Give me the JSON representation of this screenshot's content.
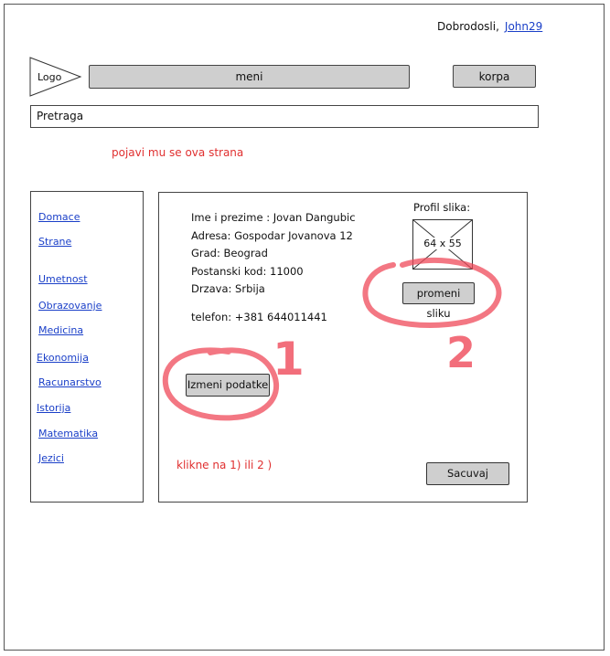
{
  "header": {
    "welcome_text": "Dobrodosli,",
    "username": "John29",
    "logo_label": "Logo",
    "menu_label": "meni",
    "cart_label": "korpa"
  },
  "search": {
    "label": "Pretraga"
  },
  "annotations": {
    "page_note": "pojavi mu se ova strana",
    "click_note": "klikne na 1) ili 2 )",
    "marker_1": "1",
    "marker_2": "2"
  },
  "sidebar": {
    "items": [
      {
        "label": "Domace"
      },
      {
        "label": "Strane"
      },
      {
        "label": "Umetnost"
      },
      {
        "label": "Obrazovanje"
      },
      {
        "label": "Medicina"
      },
      {
        "label": "Ekonomija"
      },
      {
        "label": "Racunarstvo"
      },
      {
        "label": "Istorija"
      },
      {
        "label": "Matematika"
      },
      {
        "label": "Jezici"
      }
    ]
  },
  "profile": {
    "name_line": "Ime i prezime : Jovan Dangubic",
    "address_line": "Adresa: Gospodar Jovanova 12",
    "city_line": "Grad: Beograd",
    "postal_line": "Postanski kod: 11000",
    "country_line": "Drzava: Srbija",
    "phone_line": "telefon: +381 644011441",
    "photo_label": "Profil slika:",
    "photo_size": "64 x 55"
  },
  "buttons": {
    "edit_data": "Izmeni podatke",
    "change_photo": "promeni sliku",
    "save": "Sacuvaj"
  },
  "colors": {
    "annotation_red": "#e03030",
    "link_blue": "#1a3fc8",
    "button_gray": "#cfcfcf"
  }
}
